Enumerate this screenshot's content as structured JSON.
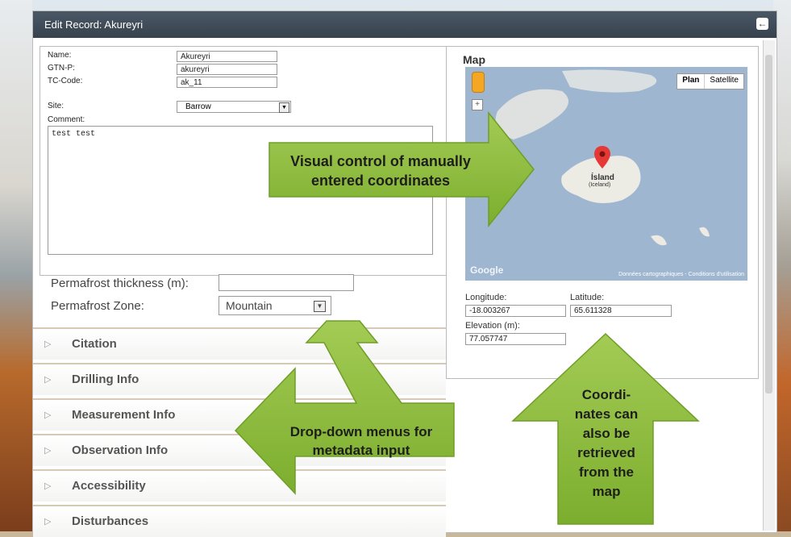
{
  "window": {
    "title": "Edit Record: Akureyri"
  },
  "form": {
    "name_label": "Name:",
    "name_value": "Akureyri",
    "gtnp_label": "GTN-P:",
    "gtnp_value": "akureyri",
    "tccode_label": "TC-Code:",
    "tccode_value": "ak_11",
    "site_label": "Site:",
    "site_value": "Barrow",
    "comment_label": "Comment:",
    "comment_value": "test test",
    "pf_thickness_label": "Permafrost thickness (m):",
    "pf_thickness_value": "",
    "pf_zone_label": "Permafrost Zone:",
    "pf_zone_value": "Mountain"
  },
  "sections": [
    {
      "label": "Citation"
    },
    {
      "label": "Drilling Info"
    },
    {
      "label": "Measurement Info"
    },
    {
      "label": "Observation Info"
    },
    {
      "label": "Accessibility"
    },
    {
      "label": "Disturbances"
    }
  ],
  "map": {
    "title": "Map",
    "type_plan": "Plan",
    "type_satellite": "Satellite",
    "place_label": "Ísland",
    "place_sublabel": "(Iceland)",
    "google": "Google",
    "footer": "Données cartographiques - Conditions d'utilisation",
    "longitude_label": "Longitude:",
    "longitude_value": "-18.003267",
    "latitude_label": "Latitude:",
    "latitude_value": "65.611328",
    "elevation_label": "Elevation (m):",
    "elevation_value": "77.057747"
  },
  "callouts": {
    "map_control": "Visual control of manually entered coordinates",
    "dropdown": "Drop-down menus for metadata input",
    "retrieve": "Coordi-nates can also be retrieved from the map"
  },
  "colors": {
    "callout_green": "#8dbd3a",
    "titlebar": "#3f4a56"
  }
}
